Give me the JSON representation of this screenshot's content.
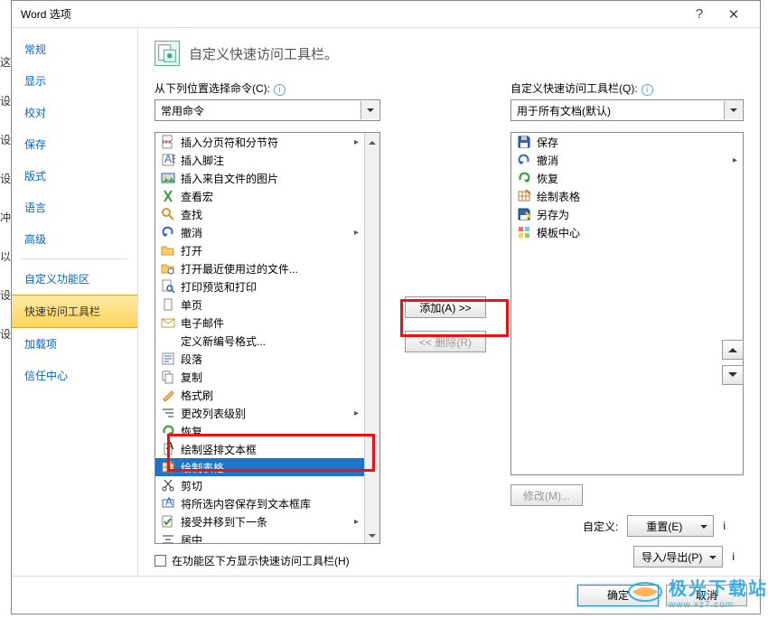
{
  "titlebar": {
    "title": "Word 选项"
  },
  "sidebar": {
    "items": [
      {
        "label": "常规"
      },
      {
        "label": "显示"
      },
      {
        "label": "校对"
      },
      {
        "label": "保存"
      },
      {
        "label": "版式"
      },
      {
        "label": "语言"
      },
      {
        "label": "高级"
      }
    ],
    "items2": [
      {
        "label": "自定义功能区"
      },
      {
        "label": "快速访问工具栏",
        "active": true
      },
      {
        "label": "加载项"
      },
      {
        "label": "信任中心"
      }
    ]
  },
  "section": {
    "title": "自定义快速访问工具栏。"
  },
  "left": {
    "label": "从下列位置选择命令(C):",
    "dd": "常用命令",
    "items": [
      {
        "icon": "page-break",
        "label": "插入分页符和分节符",
        "has_sub": true
      },
      {
        "icon": "footnote",
        "label": "插入脚注"
      },
      {
        "icon": "image",
        "label": "插入来自文件的图片"
      },
      {
        "icon": "macro",
        "label": "查看宏"
      },
      {
        "icon": "find",
        "label": "查找"
      },
      {
        "icon": "undo",
        "label": "撤消",
        "has_sub": true
      },
      {
        "icon": "open",
        "label": "打开"
      },
      {
        "icon": "recent",
        "label": "打开最近使用过的文件..."
      },
      {
        "icon": "preview",
        "label": "打印预览和打印"
      },
      {
        "icon": "page",
        "label": "单页"
      },
      {
        "icon": "email",
        "label": "电子邮件"
      },
      {
        "icon": "blank",
        "label": "定义新编号格式..."
      },
      {
        "icon": "paragraph",
        "label": "段落"
      },
      {
        "icon": "copy",
        "label": "复制"
      },
      {
        "icon": "brush",
        "label": "格式刷"
      },
      {
        "icon": "list-level",
        "label": "更改列表级别",
        "has_sub": true
      },
      {
        "icon": "redo",
        "label": "恢复"
      },
      {
        "icon": "vtext",
        "label": "绘制竖排文本框"
      },
      {
        "icon": "table",
        "label": "绘制表格",
        "selected": true
      },
      {
        "icon": "cut",
        "label": "剪切"
      },
      {
        "icon": "textbox",
        "label": "将所选内容保存到文本框库"
      },
      {
        "icon": "accept",
        "label": "接受并移到下一条",
        "has_sub": true
      },
      {
        "icon": "center",
        "label": "居中"
      }
    ],
    "below_chk": "在功能区下方显示快速访问工具栏(H)"
  },
  "right": {
    "label": "自定义快速访问工具栏(Q):",
    "dd": "用于所有文档(默认)",
    "items": [
      {
        "icon": "save",
        "label": "保存"
      },
      {
        "icon": "undo",
        "label": "撤消",
        "has_sub": true
      },
      {
        "icon": "redo",
        "label": "恢复"
      },
      {
        "icon": "table",
        "label": "绘制表格"
      },
      {
        "icon": "saveas",
        "label": "另存为"
      },
      {
        "icon": "template",
        "label": "模板中心"
      }
    ],
    "modify": "修改(M)...",
    "custom_label": "自定义:",
    "reset": "重置(E)",
    "import": "导入/导出(P)"
  },
  "mid": {
    "add": "添加(A) >>",
    "remove": "<< 删除(R)"
  },
  "footer": {
    "ok": "确定",
    "cancel": "取消"
  },
  "watermark": {
    "big": "极光下载站",
    "small": "www.xz7.com"
  },
  "edge": [
    "这",
    "设",
    "设",
    "设",
    "冲",
    "以",
    "设",
    "设"
  ]
}
